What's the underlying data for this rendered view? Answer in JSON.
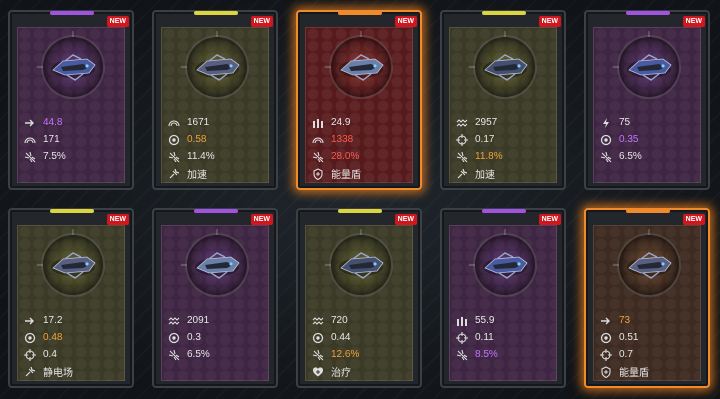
{
  "new_badge": "NEW",
  "colors": {
    "purple": "#9b4bd6",
    "yellow": "#d7d43a",
    "orange": "#f08a2a",
    "red": "#d0171f"
  },
  "cards": [
    {
      "rarity": "purple",
      "selected": false,
      "stats": [
        {
          "icon": "speed-arrow-icon",
          "value": "44.8",
          "color": "purple"
        },
        {
          "icon": "armor-arc-icon",
          "value": "171",
          "color": "white"
        },
        {
          "icon": "crit-burst-icon",
          "value": "7.5%",
          "color": "white"
        }
      ]
    },
    {
      "rarity": "yellow",
      "selected": false,
      "stats": [
        {
          "icon": "armor-arc-icon",
          "value": "1671",
          "color": "white"
        },
        {
          "icon": "target-ring-icon",
          "value": "0.58",
          "color": "orange"
        },
        {
          "icon": "crit-burst-icon",
          "value": "11.4%",
          "color": "white"
        },
        {
          "icon": "skill-icon",
          "value": "加速",
          "color": "white"
        }
      ]
    },
    {
      "rarity": "red",
      "selected": true,
      "stats": [
        {
          "icon": "ammo-icon",
          "value": "24.9",
          "color": "white"
        },
        {
          "icon": "armor-arc-icon",
          "value": "1338",
          "color": "red"
        },
        {
          "icon": "crit-burst-icon",
          "value": "28.0%",
          "color": "red"
        },
        {
          "icon": "shield-icon",
          "value": "能量盾",
          "color": "white"
        }
      ]
    },
    {
      "rarity": "yellow",
      "selected": false,
      "stats": [
        {
          "icon": "wave-icon",
          "value": "2957",
          "color": "white"
        },
        {
          "icon": "crosshair-icon",
          "value": "0.17",
          "color": "white"
        },
        {
          "icon": "crit-burst-icon",
          "value": "11.8%",
          "color": "orange"
        },
        {
          "icon": "skill-icon",
          "value": "加速",
          "color": "white"
        }
      ]
    },
    {
      "rarity": "purple",
      "selected": false,
      "stats": [
        {
          "icon": "lightning-icon",
          "value": "75",
          "color": "white"
        },
        {
          "icon": "target-ring-icon",
          "value": "0.35",
          "color": "purple"
        },
        {
          "icon": "crit-burst-icon",
          "value": "6.5%",
          "color": "white"
        }
      ]
    },
    {
      "rarity": "yellow",
      "selected": false,
      "stats": [
        {
          "icon": "speed-arrow-icon",
          "value": "17.2",
          "color": "white"
        },
        {
          "icon": "target-ring-icon",
          "value": "0.48",
          "color": "orange"
        },
        {
          "icon": "crosshair-icon",
          "value": "0.4",
          "color": "white"
        },
        {
          "icon": "skill-icon",
          "value": "静电场",
          "color": "white"
        }
      ]
    },
    {
      "rarity": "purple",
      "selected": false,
      "stats": [
        {
          "icon": "wave-icon",
          "value": "2091",
          "color": "white"
        },
        {
          "icon": "target-ring-icon",
          "value": "0.3",
          "color": "white"
        },
        {
          "icon": "crit-burst-icon",
          "value": "6.5%",
          "color": "white"
        }
      ]
    },
    {
      "rarity": "yellow",
      "selected": false,
      "stats": [
        {
          "icon": "wave-icon",
          "value": "720",
          "color": "white"
        },
        {
          "icon": "target-ring-icon",
          "value": "0.44",
          "color": "white"
        },
        {
          "icon": "crit-burst-icon",
          "value": "12.6%",
          "color": "orange"
        },
        {
          "icon": "heal-icon",
          "value": "治疗",
          "color": "white"
        }
      ]
    },
    {
      "rarity": "purple",
      "selected": false,
      "stats": [
        {
          "icon": "ammo-icon",
          "value": "55.9",
          "color": "white"
        },
        {
          "icon": "crosshair-icon",
          "value": "0.11",
          "color": "white"
        },
        {
          "icon": "crit-burst-icon",
          "value": "8.5%",
          "color": "purple"
        }
      ]
    },
    {
      "rarity": "orange",
      "selected": true,
      "stats": [
        {
          "icon": "speed-arrow-icon",
          "value": "73",
          "color": "orange"
        },
        {
          "icon": "target-ring-icon",
          "value": "0.51",
          "color": "white"
        },
        {
          "icon": "crosshair-icon",
          "value": "0.7",
          "color": "white"
        },
        {
          "icon": "shield-icon",
          "value": "能量盾",
          "color": "white"
        }
      ]
    }
  ]
}
